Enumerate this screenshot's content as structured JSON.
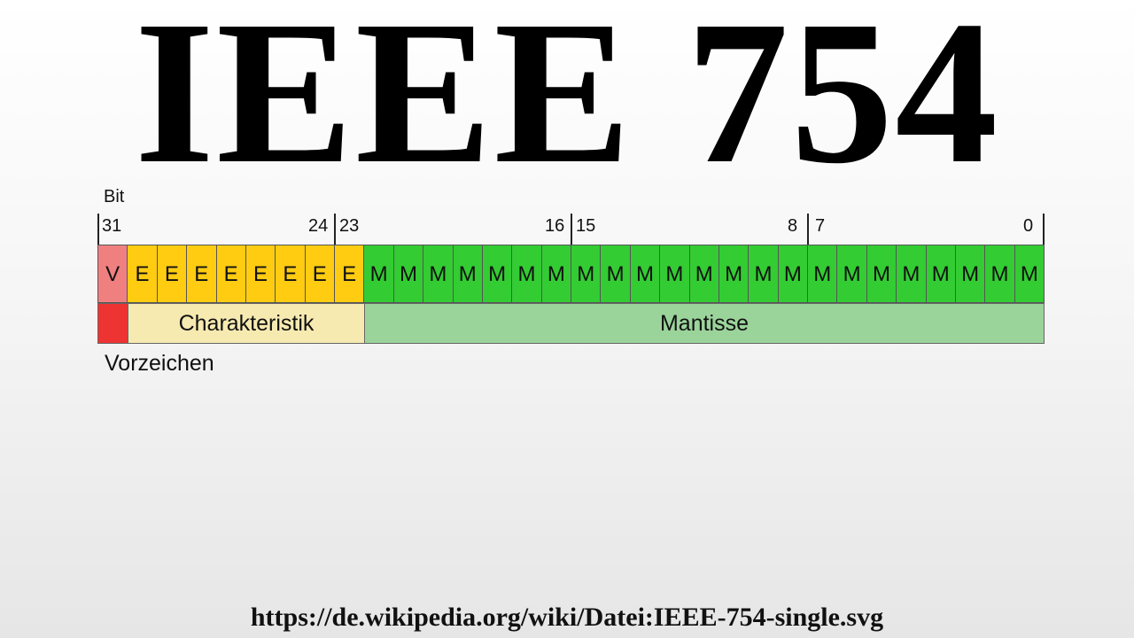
{
  "title": "IEEE 754",
  "diagram": {
    "bit_header": "Bit",
    "bit_numbers": [
      "31",
      "24",
      "23",
      "16",
      "15",
      "8",
      "7",
      "0"
    ],
    "bits": [
      "V",
      "E",
      "E",
      "E",
      "E",
      "E",
      "E",
      "E",
      "E",
      "M",
      "M",
      "M",
      "M",
      "M",
      "M",
      "M",
      "M",
      "M",
      "M",
      "M",
      "M",
      "M",
      "M",
      "M",
      "M",
      "M",
      "M",
      "M",
      "M",
      "M",
      "M",
      "M"
    ],
    "fields": {
      "sign": {
        "caption": "Vorzeichen"
      },
      "exponent": {
        "label": "Charakteristik"
      },
      "mantissa": {
        "label": "Mantisse"
      }
    },
    "colors": {
      "sign_bit": "#f08080",
      "sign_field": "#ee3333",
      "exponent_bit": "#ffcc11",
      "exponent_field": "#f7eab0",
      "mantissa_bit": "#33cc33",
      "mantissa_field": "#9bd49b"
    }
  },
  "source_url": "https://de.wikipedia.org/wiki/Datei:IEEE-754-single.svg"
}
